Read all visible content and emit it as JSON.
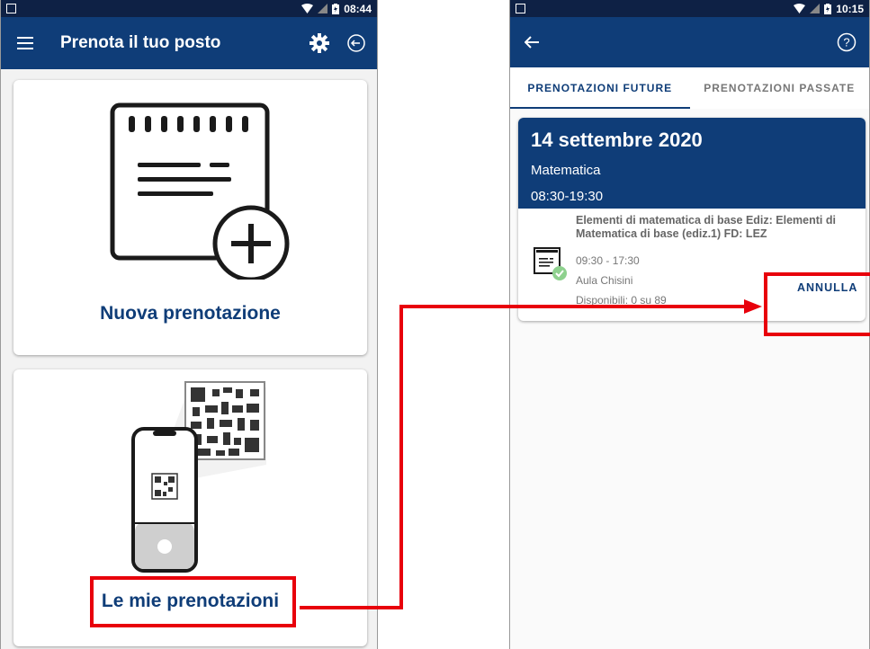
{
  "left_screen": {
    "status": {
      "time": "08:44"
    },
    "appbar": {
      "title": "Prenota il tuo posto"
    },
    "card_new": {
      "label": "Nuova prenotazione"
    },
    "card_mine": {
      "label": "Le mie prenotazioni"
    }
  },
  "right_screen": {
    "status": {
      "time": "10:15"
    },
    "tabs": [
      {
        "label": "PRENOTAZIONI FUTURE",
        "active": true
      },
      {
        "label": "PRENOTAZIONI PASSATE",
        "active": false
      }
    ],
    "booking": {
      "date": "14 settembre 2020",
      "subject": "Matematica",
      "hours": "08:30-19:30",
      "course": "Elementi di matematica di base Ediz: Elementi di Matematica di base (ediz.1) FD: LEZ",
      "time_slot": "09:30 - 17:30",
      "room": "Aula Chisini",
      "availability": "Disponibili: 0 su 89",
      "cancel_label": "ANNULLA"
    }
  },
  "colors": {
    "brand_blue": "#0f3d78",
    "status_bar": "#0e2145",
    "highlight_red": "#e8000b"
  },
  "icons": [
    "menu-icon",
    "gear-icon",
    "logout-icon",
    "back-arrow-icon",
    "help-icon",
    "wifi-icon",
    "battery-icon",
    "notepad-plus-icon",
    "qr-phone-icon",
    "booking-check-icon"
  ]
}
